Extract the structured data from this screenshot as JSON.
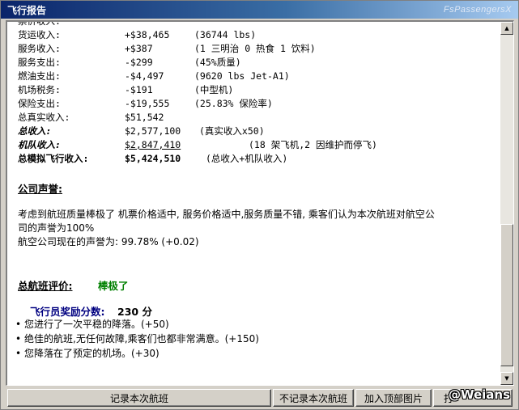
{
  "window": {
    "title": "飞行报告",
    "brand": "FsPassengersX"
  },
  "finance": {
    "rows": [
      {
        "label": "货运收入:",
        "value": "+$38,465",
        "note": "(36744 lbs)"
      },
      {
        "label": "服务收入:",
        "value": "+$387",
        "note": "(1 三明治 0 热食 1 饮料)"
      },
      {
        "label": "服务支出:",
        "value": "-$299",
        "note": "(45%质量)"
      },
      {
        "label": "燃油支出:",
        "value": "-$4,497",
        "note": "(9620 lbs Jet-A1)"
      },
      {
        "label": "机场税务:",
        "value": "-$191",
        "note": "(中型机)"
      },
      {
        "label": "保险支出:",
        "value": "-$19,555",
        "note": "(25.83% 保险率)"
      },
      {
        "label": "总真实收入:",
        "value": "$51,542",
        "note": ""
      }
    ],
    "total_income": {
      "label": "总收入:",
      "value": "$2,577,100",
      "note": "(真实收入x50)"
    },
    "fleet_income": {
      "label": "机队收入:",
      "value": "$2,847,410",
      "note": "(18 架飞机,2 因维护而停飞)"
    },
    "sim_income": {
      "label": "总模拟飞行收入:",
      "value": "$5,424,510",
      "note": "(总收入+机队收入)"
    }
  },
  "reputation": {
    "title": "公司声誉:",
    "line1": "考虑到航班质量棒极了 机票价格适中, 服务价格适中,服务质量不错, 乘客们认为本次航班对航空公",
    "line2": "司的声誉为100%",
    "line3": "航空公司现在的声誉为: 99.78% (+0.02)"
  },
  "rating": {
    "label": "总航班评价:",
    "value": "棒极了"
  },
  "bonus": {
    "label": "飞行员奖励分数:",
    "value": "230 分",
    "items": [
      "您进行了一次平稳的降落。(+50)",
      "绝佳的航班,无任何故障,乘客们也都非常满意。(+150)",
      "您降落在了预定的机场。(+30)"
    ]
  },
  "buttons": {
    "record": "记录本次航班",
    "no_record": "不记录本次航班",
    "add_image": "加入顶部图片",
    "print": "打"
  },
  "watermark": "@Weians"
}
